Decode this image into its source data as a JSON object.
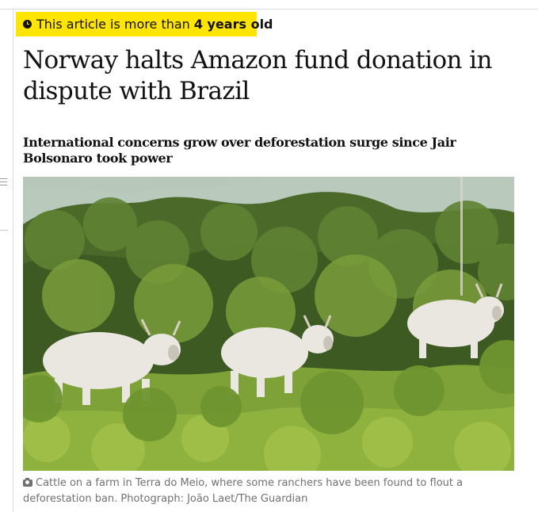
{
  "age_badge": {
    "prefix": "This article is more than",
    "age": "4 years old"
  },
  "headline": "Norway halts Amazon fund donation in dispute with Brazil",
  "standfirst": "International concerns grow over deforestation surge since Jair Bolsonaro took power",
  "main_image": {
    "icon": "camera-icon",
    "caption": "Cattle on a farm in Terra do Meio, where some ranchers have been found to flout a deforestation ban. Photograph: João Laet/The Guardian"
  },
  "colors": {
    "badge_background": "#ffe500",
    "text": "#121212",
    "caption_text": "#707070"
  }
}
